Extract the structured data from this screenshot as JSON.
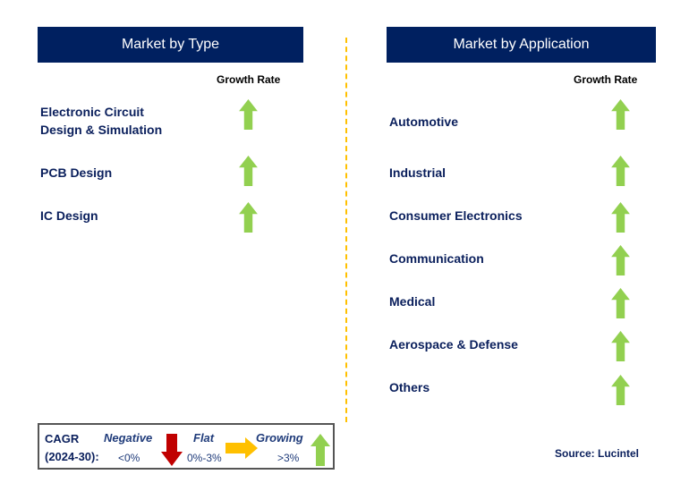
{
  "colors": {
    "header": "#002060",
    "growing": "#92D050",
    "negative": "#C00000",
    "flat": "#FFC000",
    "divider": "#FFC000"
  },
  "type_panel": {
    "title": "Market by Type",
    "growth_rate_label": "Growth Rate",
    "items": [
      {
        "label": "Electronic Circuit\nDesign & Simulation",
        "trend": "growing"
      },
      {
        "label": "PCB Design",
        "trend": "growing"
      },
      {
        "label": "IC Design",
        "trend": "growing"
      }
    ]
  },
  "application_panel": {
    "title": "Market by Application",
    "growth_rate_label": "Growth Rate",
    "items": [
      {
        "label": "Automotive",
        "trend": "growing"
      },
      {
        "label": "Industrial",
        "trend": "growing"
      },
      {
        "label": "Consumer Electronics",
        "trend": "growing"
      },
      {
        "label": "Communication",
        "trend": "growing"
      },
      {
        "label": "Medical",
        "trend": "growing"
      },
      {
        "label": "Aerospace & Defense",
        "trend": "growing"
      },
      {
        "label": "Others",
        "trend": "growing"
      }
    ]
  },
  "legend": {
    "cagr": "CAGR",
    "period": "(2024-30):",
    "negative": "Negative",
    "negative_range": "<0%",
    "flat": "Flat",
    "flat_range": "0%-3%",
    "growing": "Growing",
    "growing_range": ">3%"
  },
  "source": "Source: Lucintel"
}
